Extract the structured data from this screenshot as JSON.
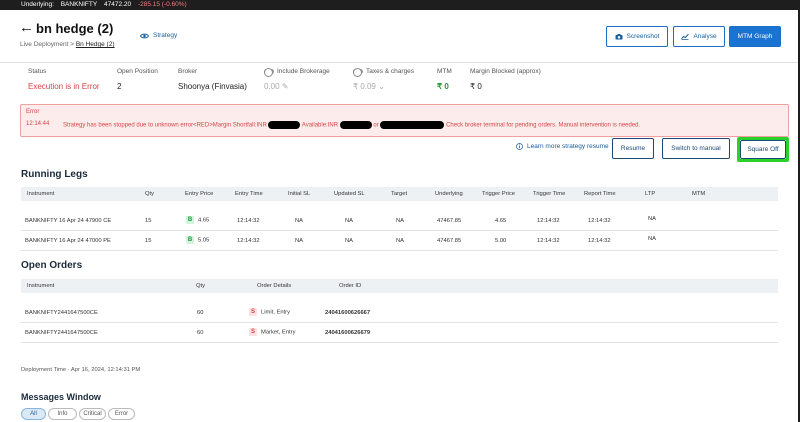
{
  "ticker": {
    "label": "Underlying:",
    "symbol": "BANKNIFTY",
    "price": "47472.20",
    "change": "-285.15 (-0.60%)"
  },
  "header": {
    "title": "bn hedge (2)",
    "strategy_link": "Strategy",
    "breadcrumb": {
      "parent": "Live Deployment",
      "current": "Bn Hedge (2)"
    },
    "buttons": {
      "screenshot": "Screenshot",
      "analyse": "Analyse",
      "mtm_graph": "MTM Graph"
    }
  },
  "stats": {
    "status": {
      "label": "Status",
      "value": "Execution is in Error"
    },
    "open_position": {
      "label": "Open Position",
      "value": "2"
    },
    "broker": {
      "label": "Broker",
      "value": "Shoonya (Finvasia)"
    },
    "include_brokerage": {
      "label": "Include Brokerage",
      "value": "0.00"
    },
    "taxes": {
      "label": "Taxes & charges",
      "value": "₹ 0.09"
    },
    "mtm": {
      "label": "MTM",
      "value": "₹ 0"
    },
    "margin_blocked": {
      "label": "Margin Blocked (approx)",
      "value": "₹ 0"
    }
  },
  "error": {
    "title": "Error",
    "time": "12:14:44",
    "message_part1": "Strategy has been stopped due to unknown error<RED>Margin Shortfall:INR",
    "message_part2": "Available:INR",
    "message_part3": "or",
    "message_part4": "Check broker terminal for pending orders. Manual intervention is needed."
  },
  "actions": {
    "learn_more": "Learn more strategy resume",
    "resume": "Resume",
    "switch_manual": "Switch to manual",
    "square_off": "Square Off"
  },
  "running_legs": {
    "title": "Running Legs",
    "columns": [
      "Instrument",
      "Qty",
      "Entry Price",
      "Entry Time",
      "Initial SL",
      "Updated SL",
      "Target",
      "Underlying",
      "Trigger Price",
      "Trigger Time",
      "Report Time",
      "LTP",
      "MTM"
    ],
    "rows": [
      {
        "instrument": "BANKNIFTY 16 Apr 24 47900 CE",
        "qty": "15",
        "side": "B",
        "entry_price": "4.65",
        "entry_time": "12:14:32",
        "initial_sl": "NA",
        "updated_sl": "NA",
        "target": "NA",
        "underlying": "47467.85",
        "trigger_price": "4.65",
        "trigger_time": "12:14:32",
        "report_time": "12:14:32",
        "ltp": "NA",
        "mtm": ""
      },
      {
        "instrument": "BANKNIFTY 16 Apr 24 47000 PE",
        "qty": "15",
        "side": "B",
        "entry_price": "5.05",
        "entry_time": "12:14:32",
        "initial_sl": "NA",
        "updated_sl": "NA",
        "target": "NA",
        "underlying": "47467.85",
        "trigger_price": "5.00",
        "trigger_time": "12:14:32",
        "report_time": "12:14:32",
        "ltp": "NA",
        "mtm": ""
      }
    ]
  },
  "open_orders": {
    "title": "Open Orders",
    "columns": [
      "Instrument",
      "Qty",
      "Order Details",
      "Order ID"
    ],
    "rows": [
      {
        "instrument": "BANKNIFTY2441647500CE",
        "qty": "60",
        "side": "S",
        "details": "Limit, Entry",
        "order_id": "24041600626667"
      },
      {
        "instrument": "BANKNIFTY2441647500CE",
        "qty": "60",
        "side": "S",
        "details": "Market, Entry",
        "order_id": "24041600626679"
      }
    ]
  },
  "deployment_time": "Deployment Time · Apr 16, 2024, 12:14:31 PM",
  "messages": {
    "title": "Messages Window",
    "filters": [
      "All",
      "Info",
      "Critical",
      "Error"
    ]
  },
  "colors": {
    "accent": "#1a73d0",
    "error": "#d64545",
    "success": "#1a9a3c",
    "highlight": "#2ad12a"
  }
}
